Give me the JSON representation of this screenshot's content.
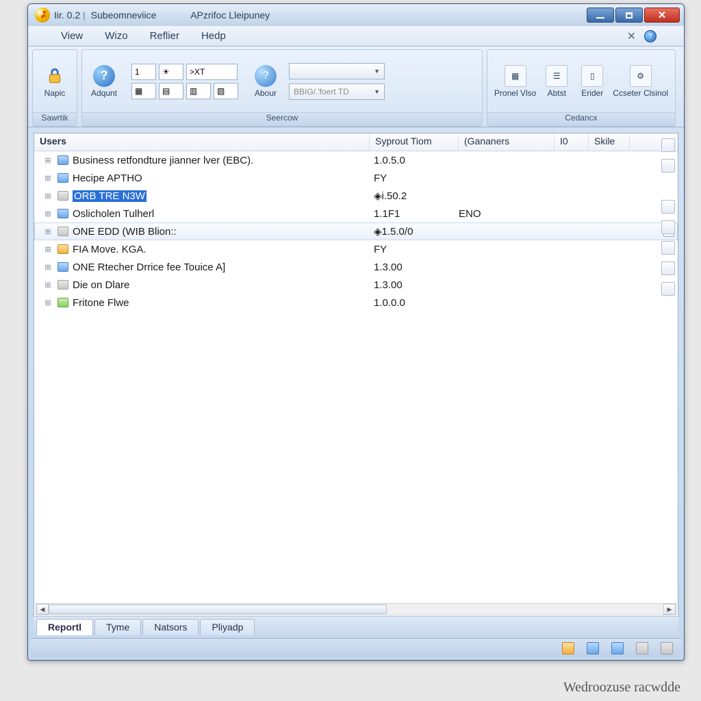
{
  "titlebar": {
    "left": "Iir. 0.2",
    "mid": "Subeomneviice",
    "right": "APzrifoc Lleipuney"
  },
  "menu": {
    "m1": "View",
    "m2": "Wizo",
    "m3": "Reflier",
    "m4": "Hedp"
  },
  "ribbon": {
    "g1": {
      "label": "Sawrtik",
      "b1": "Napic"
    },
    "g2": {
      "label": "",
      "b1": "Adqunt"
    },
    "g3": {
      "label": "Seercow",
      "input": ">XT",
      "about": "Abour",
      "drop1": "",
      "drop2": "BBIG/.'foert TD"
    },
    "g4": {
      "label": "Cedancx",
      "b1": "Pronel Vlso",
      "b2": "Abtst",
      "b3": "Erider",
      "b4": "Ccseter Clsinol"
    }
  },
  "columns": {
    "c1": "Users",
    "c2": "Syprout Tiom",
    "c3": "(Gananers",
    "c4": "I0",
    "c5": "Skile"
  },
  "rows": [
    {
      "name": "Business retfondture jianner lver (EBC).",
      "val": "1.0.5.0",
      "gan": "",
      "icon": "blue"
    },
    {
      "name": "Hecipe APTHO",
      "val": "FY",
      "gan": "",
      "icon": "blue"
    },
    {
      "name": "ORB TRE N3W",
      "val": "◈i.50.2",
      "gan": "",
      "icon": "gray",
      "selected": true
    },
    {
      "name": "Oslicholen Tulherl",
      "val": "1.1F1",
      "gan": "ENO",
      "icon": "blue"
    },
    {
      "name": "ONE EDD (WIB Blion::",
      "val": "◈1.5.0/0",
      "gan": "",
      "icon": "gray",
      "hover": true
    },
    {
      "name": "FIA Move. KGA.",
      "val": "FY",
      "gan": "",
      "icon": "orange"
    },
    {
      "name": "ONE Rtecher Drrice fee Touice A]",
      "val": "1.3.00",
      "gan": "",
      "icon": "blue"
    },
    {
      "name": "Die on Dlare",
      "val": "1.3.00",
      "gan": "",
      "icon": "gray"
    },
    {
      "name": "Fritone Flwe",
      "val": "1.0.0.0",
      "gan": "",
      "icon": "green"
    }
  ],
  "tabs": {
    "t1": "Reportl",
    "t2": "Tyme",
    "t3": "Natsors",
    "t4": "Pliyadp"
  },
  "watermark": "Wedroozuse racwdde"
}
